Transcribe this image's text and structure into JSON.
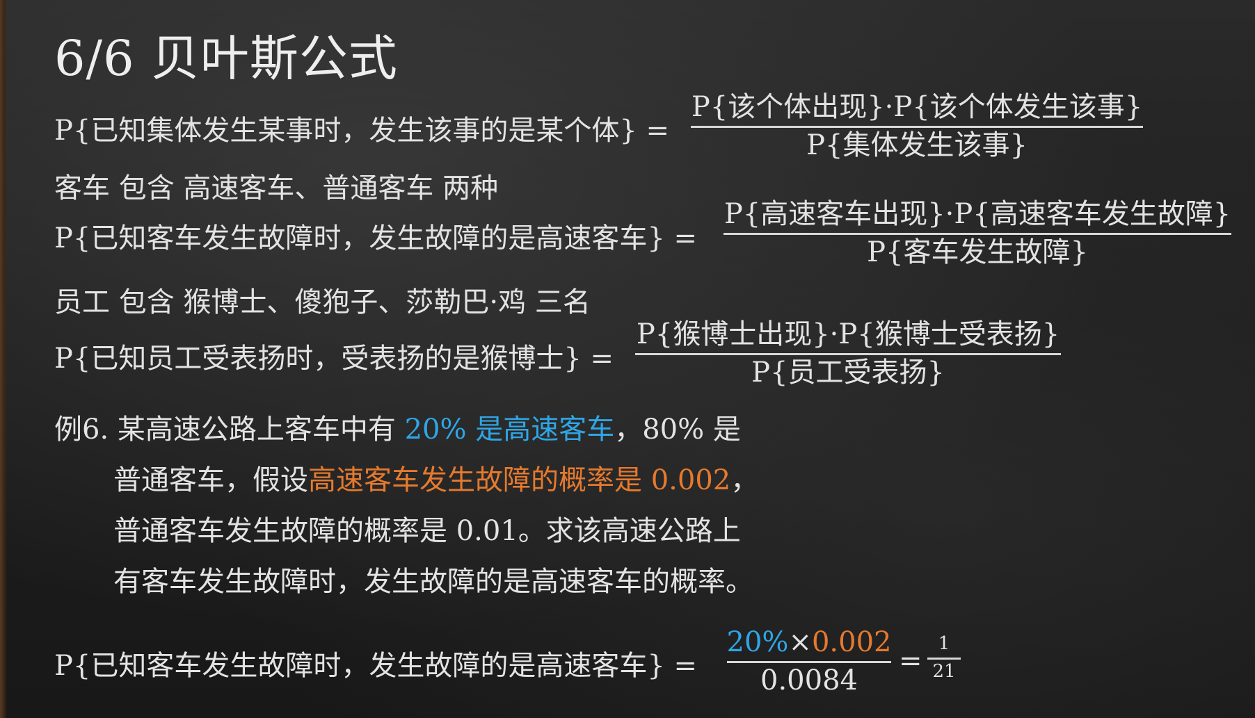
{
  "title": "6/6  贝叶斯公式",
  "formula1": {
    "lhs": "P{已知集体发生某事时，发生该事的是某个体}",
    "eq": "=",
    "num": "P{该个体出现}·P{该个体发生该事}",
    "den": "P{集体发生该事}"
  },
  "line_car": "客车 包含 高速客车、普通客车 两种",
  "formula2": {
    "lhs": "P{已知客车发生故障时，发生故障的是高速客车}",
    "eq": "=",
    "num": "P{高速客车出现}·P{高速客车发生故障}",
    "den": "P{客车发生故障}"
  },
  "line_staff": "员工 包含 猴博士、傻狍子、莎勒巴·鸡 三名",
  "formula3": {
    "lhs": "P{已知员工受表扬时，受表扬的是猴博士}",
    "eq": "=",
    "num": "P{猴博士出现}·P{猴博士受表扬}",
    "den": "P{员工受表扬}"
  },
  "example": {
    "l1_a": "例6. 某高速公路上客车中有 ",
    "l1_blue": "20% 是高速客车",
    "l1_b": "，80% 是",
    "l2_a": "普通客车，假设",
    "l2_orange": "高速客车发生故障的概率是 0.002",
    "l2_b": "，",
    "l3": "普通客车发生故障的概率是 0.01。求该高速公路上",
    "l4": "有客车发生故障时，发生故障的是高速客车的概率。"
  },
  "answer": {
    "lhs": "P{已知客车发生故障时，发生故障的是高速客车}",
    "eq1": "=",
    "num_blue": "20%",
    "times": "×",
    "num_orange": "0.002",
    "den_yellow": "0.0084",
    "eq2": "=",
    "result_num": "1",
    "result_den": "21"
  },
  "colors": {
    "blue": "#2fa6e6",
    "orange": "#e57a2e",
    "yellow": "#f1b623",
    "text": "#e3e3e3"
  }
}
